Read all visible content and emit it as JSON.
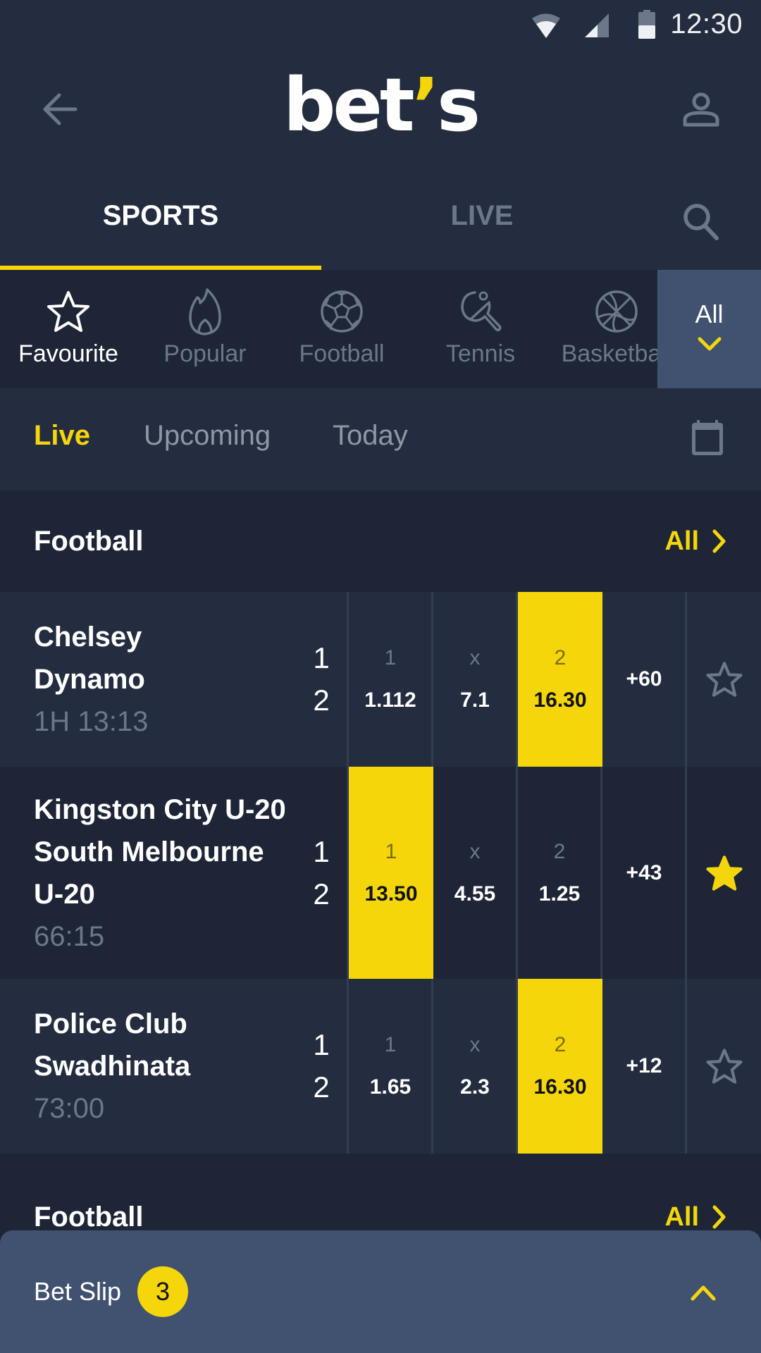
{
  "status_bar": {
    "time": "12:30",
    "icons": [
      "wifi-icon",
      "cell-signal-icon",
      "battery-icon"
    ]
  },
  "header": {
    "logo_main": "bet",
    "logo_apostrophe": "’",
    "logo_suffix": "s",
    "back_icon": "arrow-left-icon",
    "profile_icon": "user-icon"
  },
  "main_tabs": {
    "items": [
      {
        "label": "SPORTS",
        "active": true
      },
      {
        "label": "LIVE",
        "active": false
      }
    ],
    "search_icon": "search-icon"
  },
  "categories": {
    "items": [
      {
        "label": "Favourite",
        "icon": "star-outline-icon",
        "active": true
      },
      {
        "label": "Popular",
        "icon": "flame-icon",
        "active": false
      },
      {
        "label": "Football",
        "icon": "soccer-ball-icon",
        "active": false
      },
      {
        "label": "Tennis",
        "icon": "table-tennis-icon",
        "active": false
      },
      {
        "label": "Basketball",
        "icon": "basketball-icon",
        "active": false
      }
    ],
    "all_label": "All",
    "all_icon": "chevron-down-icon"
  },
  "filters": {
    "items": [
      {
        "label": "Live",
        "active": true
      },
      {
        "label": "Upcoming",
        "active": false
      },
      {
        "label": "Today",
        "active": false
      }
    ],
    "calendar_icon": "calendar-icon"
  },
  "sections": [
    {
      "title": "Football",
      "all_label": "All",
      "matches": [
        {
          "teams": [
            "Chelsey",
            "Dynamo"
          ],
          "time": "1H 13:13",
          "scores": [
            "1",
            "2"
          ],
          "odds": [
            {
              "label": "1",
              "value": "1.112",
              "selected": false
            },
            {
              "label": "x",
              "value": "7.1",
              "selected": false
            },
            {
              "label": "2",
              "value": "16.30",
              "selected": true
            }
          ],
          "more": "+60",
          "favourite": false
        },
        {
          "teams": [
            "Kingston City U-20",
            "South Melbourne",
            "U-20"
          ],
          "time": "66:15",
          "scores": [
            "1",
            "2"
          ],
          "odds": [
            {
              "label": "1",
              "value": "13.50",
              "selected": true
            },
            {
              "label": "x",
              "value": "4.55",
              "selected": false
            },
            {
              "label": "2",
              "value": "1.25",
              "selected": false
            }
          ],
          "more": "+43",
          "favourite": true
        },
        {
          "teams": [
            "Police Club",
            "Swadhinata"
          ],
          "time": "73:00",
          "scores": [
            "1",
            "2"
          ],
          "odds": [
            {
              "label": "1",
              "value": "1.65",
              "selected": false
            },
            {
              "label": "x",
              "value": "2.3",
              "selected": false
            },
            {
              "label": "2",
              "value": "16.30",
              "selected": true
            }
          ],
          "more": "+12",
          "favourite": false
        }
      ]
    },
    {
      "title": "Football",
      "all_label": "All",
      "matches": []
    }
  ],
  "bet_slip": {
    "label": "Bet Slip",
    "count": "3",
    "toggle_icon": "chevron-up-icon"
  },
  "colors": {
    "accent": "#f5d60a",
    "background": "#1e2537",
    "surface": "#242d40",
    "muted_text": "#6c7789",
    "panel": "#415270"
  }
}
